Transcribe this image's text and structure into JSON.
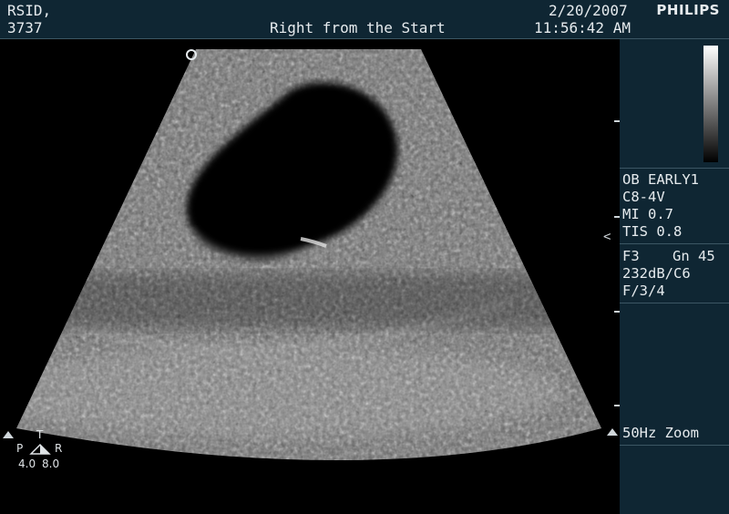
{
  "header": {
    "patient_name": "RSID,",
    "patient_id": "3737",
    "clinic": "Right from the Start",
    "date": "2/20/2007",
    "time": "11:56:42 AM",
    "brand": "PHILIPS"
  },
  "settings": {
    "preset": "OB EARLY1",
    "transducer": "C8-4V",
    "mi": "MI 0.7",
    "tis": "TIS 0.8",
    "frequency": "F3",
    "gain": "Gn 45",
    "dynamic_range": "232dB/C6",
    "persistence": "F/3/4",
    "frame_rate_zoom": "50Hz Zoom"
  },
  "orientation": {
    "p_label": "P",
    "t_label": "T",
    "r_label": "R",
    "depth_left": "4.0",
    "depth_right": "8.0"
  },
  "indicators": {
    "focus_marker": "<"
  },
  "colors": {
    "panel_bg": "#0f2633",
    "text": "#e6ebee"
  }
}
